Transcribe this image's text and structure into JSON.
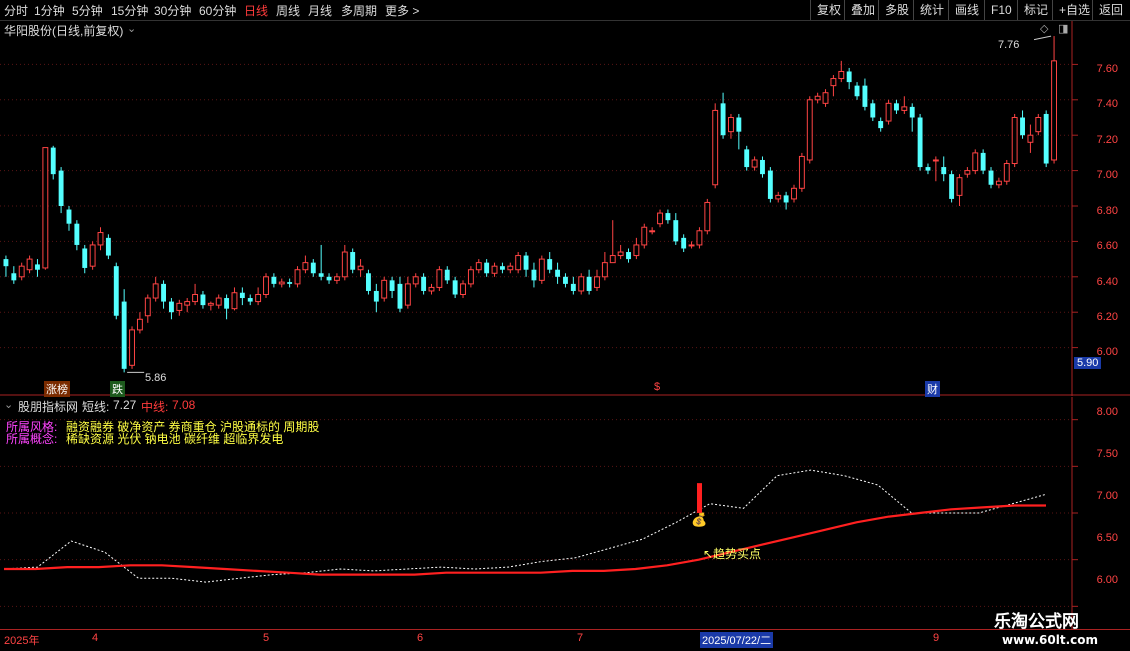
{
  "toolbar": {
    "left_items": [
      "分时",
      "1分钟",
      "5分钟",
      "15分钟",
      "30分钟",
      "60分钟",
      "日线",
      "周线",
      "月线",
      "多周期",
      "更多 >"
    ],
    "active_item": "日线",
    "right_items": [
      "复权",
      "叠加",
      "多股",
      "统计",
      "画线",
      "F10",
      "标记",
      "+自选",
      "返回"
    ]
  },
  "main": {
    "title": "华阳股份(日线,前复权)",
    "price_axis": [
      "7.60",
      "7.40",
      "7.20",
      "7.00",
      "6.80",
      "6.60",
      "6.40",
      "6.20",
      "6.00"
    ],
    "current_price": "5.90",
    "high_label": "7.76",
    "low_label": "5.86",
    "tags": {
      "zhangbang": "涨榜",
      "die": "跌",
      "cai": "财",
      "dollar": "$"
    }
  },
  "indicator": {
    "name": "股朋指标网",
    "short_label": "短线:",
    "short_value": "7.27",
    "mid_label": "中线:",
    "mid_value": "7.08",
    "style_label": "所属风格:",
    "style_value": "融资融券 破净资产 券商重仓 沪股通标的 周期股",
    "concept_label": "所属概念:",
    "concept_value": "稀缺资源 光伏 钠电池 碳纤维 超临界发电",
    "buy_point": "↖趋势买点",
    "axis": [
      "8.00",
      "7.50",
      "7.00",
      "6.50",
      "6.00"
    ]
  },
  "dates": {
    "labels": [
      "2025年",
      "4",
      "5",
      "6",
      "7",
      "2025/07/22/二",
      "9"
    ]
  },
  "watermark": {
    "title": "乐淘公式网",
    "url": "www.60lt.com"
  },
  "colors": {
    "up": "#ff4444",
    "down": "#54ffff",
    "mid_line": "#ff2020",
    "short_line": "#ffffff",
    "style_label": "#ff44ff",
    "style_value": "#ffff44"
  },
  "chart_data": {
    "type": "candlestick",
    "ylim": [
      5.8,
      7.8
    ],
    "candles": [
      [
        6.5,
        6.46,
        6.52,
        6.4
      ],
      [
        6.42,
        6.38,
        6.46,
        6.36
      ],
      [
        6.4,
        6.46,
        6.48,
        6.38
      ],
      [
        6.44,
        6.5,
        6.52,
        6.42
      ],
      [
        6.47,
        6.44,
        6.5,
        6.4
      ],
      [
        6.45,
        7.13,
        7.13,
        6.44
      ],
      [
        7.13,
        6.98,
        7.14,
        6.95
      ],
      [
        7.0,
        6.8,
        7.02,
        6.76
      ],
      [
        6.78,
        6.7,
        6.8,
        6.66
      ],
      [
        6.7,
        6.58,
        6.72,
        6.55
      ],
      [
        6.56,
        6.45,
        6.58,
        6.42
      ],
      [
        6.46,
        6.58,
        6.6,
        6.44
      ],
      [
        6.58,
        6.65,
        6.68,
        6.55
      ],
      [
        6.62,
        6.52,
        6.64,
        6.5
      ],
      [
        6.46,
        6.18,
        6.48,
        6.16
      ],
      [
        6.26,
        5.88,
        6.33,
        5.86
      ],
      [
        5.9,
        6.1,
        6.12,
        5.88
      ],
      [
        6.1,
        6.16,
        6.2,
        6.08
      ],
      [
        6.18,
        6.28,
        6.3,
        6.14
      ],
      [
        6.28,
        6.36,
        6.4,
        6.26
      ],
      [
        6.36,
        6.26,
        6.38,
        6.22
      ],
      [
        6.26,
        6.2,
        6.28,
        6.16
      ],
      [
        6.21,
        6.25,
        6.27,
        6.18
      ],
      [
        6.24,
        6.26,
        6.28,
        6.2
      ],
      [
        6.26,
        6.3,
        6.36,
        6.24
      ],
      [
        6.3,
        6.24,
        6.32,
        6.22
      ],
      [
        6.24,
        6.25,
        6.26,
        6.21
      ],
      [
        6.24,
        6.28,
        6.3,
        6.22
      ],
      [
        6.28,
        6.22,
        6.3,
        6.16
      ],
      [
        6.22,
        6.31,
        6.34,
        6.21
      ],
      [
        6.31,
        6.28,
        6.34,
        6.24
      ],
      [
        6.28,
        6.26,
        6.3,
        6.24
      ],
      [
        6.26,
        6.3,
        6.34,
        6.24
      ],
      [
        6.3,
        6.4,
        6.42,
        6.28
      ],
      [
        6.4,
        6.36,
        6.42,
        6.34
      ],
      [
        6.36,
        6.37,
        6.39,
        6.34
      ],
      [
        6.37,
        6.36,
        6.39,
        6.34
      ],
      [
        6.36,
        6.44,
        6.46,
        6.34
      ],
      [
        6.44,
        6.48,
        6.52,
        6.42
      ],
      [
        6.48,
        6.42,
        6.5,
        6.4
      ],
      [
        6.42,
        6.4,
        6.58,
        6.38
      ],
      [
        6.4,
        6.38,
        6.42,
        6.36
      ],
      [
        6.38,
        6.4,
        6.42,
        6.36
      ],
      [
        6.4,
        6.54,
        6.58,
        6.38
      ],
      [
        6.54,
        6.44,
        6.56,
        6.42
      ],
      [
        6.44,
        6.46,
        6.5,
        6.4
      ],
      [
        6.42,
        6.32,
        6.44,
        6.3
      ],
      [
        6.32,
        6.26,
        6.36,
        6.2
      ],
      [
        6.28,
        6.38,
        6.4,
        6.26
      ],
      [
        6.38,
        6.32,
        6.4,
        6.28
      ],
      [
        6.36,
        6.22,
        6.4,
        6.2
      ],
      [
        6.24,
        6.36,
        6.4,
        6.22
      ],
      [
        6.36,
        6.4,
        6.42,
        6.34
      ],
      [
        6.4,
        6.32,
        6.42,
        6.3
      ],
      [
        6.32,
        6.34,
        6.36,
        6.3
      ],
      [
        6.34,
        6.44,
        6.46,
        6.32
      ],
      [
        6.44,
        6.38,
        6.46,
        6.36
      ],
      [
        6.38,
        6.3,
        6.4,
        6.28
      ],
      [
        6.3,
        6.36,
        6.38,
        6.28
      ],
      [
        6.36,
        6.44,
        6.46,
        6.34
      ],
      [
        6.44,
        6.48,
        6.5,
        6.42
      ],
      [
        6.48,
        6.42,
        6.5,
        6.4
      ],
      [
        6.42,
        6.46,
        6.48,
        6.4
      ],
      [
        6.46,
        6.44,
        6.48,
        6.42
      ],
      [
        6.44,
        6.46,
        6.48,
        6.42
      ],
      [
        6.44,
        6.52,
        6.54,
        6.42
      ],
      [
        6.52,
        6.44,
        6.54,
        6.4
      ],
      [
        6.44,
        6.38,
        6.48,
        6.34
      ],
      [
        6.38,
        6.5,
        6.52,
        6.36
      ],
      [
        6.5,
        6.44,
        6.54,
        6.42
      ],
      [
        6.44,
        6.4,
        6.48,
        6.36
      ],
      [
        6.4,
        6.36,
        6.42,
        6.34
      ],
      [
        6.36,
        6.32,
        6.4,
        6.3
      ],
      [
        6.32,
        6.4,
        6.42,
        6.3
      ],
      [
        6.4,
        6.32,
        6.44,
        6.3
      ],
      [
        6.34,
        6.4,
        6.44,
        6.32
      ],
      [
        6.4,
        6.48,
        6.54,
        6.38
      ],
      [
        6.48,
        6.52,
        6.72,
        6.5
      ],
      [
        6.52,
        6.54,
        6.58,
        6.5
      ],
      [
        6.54,
        6.5,
        6.56,
        6.48
      ],
      [
        6.52,
        6.58,
        6.62,
        6.5
      ],
      [
        6.58,
        6.68,
        6.7,
        6.56
      ],
      [
        6.66,
        6.66,
        6.68,
        6.64
      ],
      [
        6.7,
        6.76,
        6.78,
        6.68
      ],
      [
        6.76,
        6.72,
        6.78,
        6.7
      ],
      [
        6.72,
        6.6,
        6.76,
        6.58
      ],
      [
        6.62,
        6.56,
        6.64,
        6.54
      ],
      [
        6.58,
        6.58,
        6.6,
        6.56
      ],
      [
        6.58,
        6.66,
        6.68,
        6.56
      ],
      [
        6.66,
        6.82,
        6.84,
        6.64
      ],
      [
        6.92,
        7.34,
        7.38,
        6.9
      ],
      [
        7.38,
        7.2,
        7.44,
        7.18
      ],
      [
        7.22,
        7.3,
        7.32,
        7.18
      ],
      [
        7.3,
        7.22,
        7.32,
        7.12
      ],
      [
        7.12,
        7.02,
        7.14,
        7.0
      ],
      [
        7.02,
        7.06,
        7.08,
        7.0
      ],
      [
        7.06,
        6.98,
        7.08,
        6.96
      ],
      [
        7.0,
        6.84,
        7.02,
        6.82
      ],
      [
        6.84,
        6.86,
        6.88,
        6.82
      ],
      [
        6.86,
        6.82,
        6.88,
        6.78
      ],
      [
        6.84,
        6.9,
        6.92,
        6.82
      ],
      [
        6.9,
        7.08,
        7.1,
        6.88
      ],
      [
        7.06,
        7.4,
        7.42,
        7.04
      ],
      [
        7.4,
        7.42,
        7.44,
        7.38
      ],
      [
        7.38,
        7.44,
        7.46,
        7.36
      ],
      [
        7.48,
        7.52,
        7.54,
        7.42
      ],
      [
        7.52,
        7.56,
        7.62,
        7.5
      ],
      [
        7.56,
        7.5,
        7.58,
        7.46
      ],
      [
        7.48,
        7.42,
        7.5,
        7.4
      ],
      [
        7.48,
        7.36,
        7.52,
        7.34
      ],
      [
        7.38,
        7.3,
        7.4,
        7.28
      ],
      [
        7.28,
        7.24,
        7.3,
        7.22
      ],
      [
        7.28,
        7.38,
        7.4,
        7.26
      ],
      [
        7.38,
        7.34,
        7.4,
        7.32
      ],
      [
        7.34,
        7.36,
        7.42,
        7.32
      ],
      [
        7.36,
        7.3,
        7.38,
        7.22
      ],
      [
        7.3,
        7.02,
        7.32,
        7.0
      ],
      [
        7.02,
        7.0,
        7.04,
        6.98
      ],
      [
        7.06,
        7.06,
        7.08,
        6.94
      ],
      [
        7.02,
        6.98,
        7.08,
        6.94
      ],
      [
        6.98,
        6.84,
        7.0,
        6.82
      ],
      [
        6.86,
        6.96,
        6.98,
        6.8
      ],
      [
        6.98,
        7.0,
        7.02,
        6.96
      ],
      [
        7.0,
        7.1,
        7.12,
        6.98
      ],
      [
        7.1,
        7.0,
        7.12,
        6.98
      ],
      [
        7.0,
        6.92,
        7.02,
        6.9
      ],
      [
        6.92,
        6.94,
        6.96,
        6.9
      ],
      [
        6.94,
        7.04,
        7.06,
        6.92
      ],
      [
        7.04,
        7.3,
        7.32,
        7.02
      ],
      [
        7.3,
        7.2,
        7.34,
        7.18
      ],
      [
        7.16,
        7.2,
        7.26,
        7.1
      ],
      [
        7.22,
        7.3,
        7.32,
        7.2
      ],
      [
        7.32,
        7.04,
        7.34,
        7.02
      ],
      [
        7.06,
        7.62,
        7.76,
        7.04
      ]
    ],
    "indicator_ylim": [
      5.8,
      8.2
    ],
    "mid_line": [
      6.4,
      6.4,
      6.42,
      6.42,
      6.44,
      6.44,
      6.42,
      6.4,
      6.38,
      6.36,
      6.34,
      6.34,
      6.34,
      6.34,
      6.36,
      6.36,
      6.36,
      6.36,
      6.38,
      6.38,
      6.4,
      6.44,
      6.5,
      6.58,
      6.66,
      6.74,
      6.82,
      6.9,
      6.96,
      7.0,
      7.04,
      7.06,
      7.08,
      7.08
    ],
    "short_line": [
      6.4,
      6.42,
      6.7,
      6.58,
      6.3,
      6.3,
      6.26,
      6.3,
      6.34,
      6.36,
      6.4,
      6.38,
      6.4,
      6.42,
      6.4,
      6.42,
      6.48,
      6.52,
      6.62,
      6.72,
      6.9,
      7.1,
      7.05,
      7.4,
      7.46,
      7.4,
      7.3,
      7.0,
      7.0,
      7.0,
      7.1,
      7.2
    ]
  }
}
